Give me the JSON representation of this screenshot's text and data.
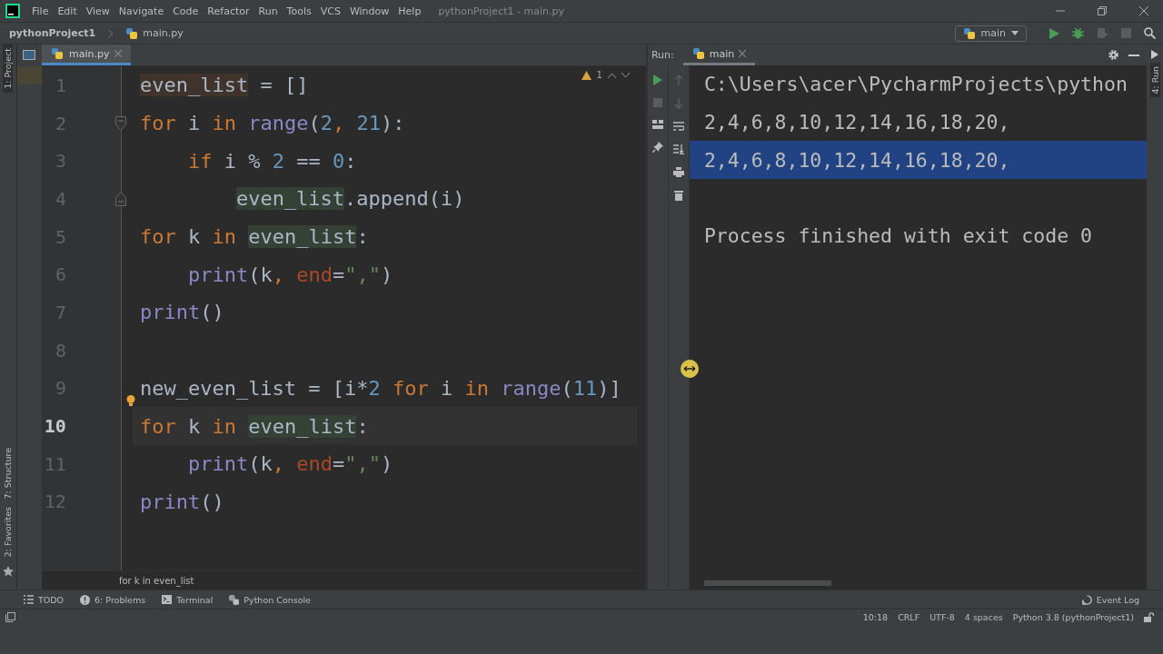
{
  "menu": {
    "items": [
      "File",
      "Edit",
      "View",
      "Navigate",
      "Code",
      "Refactor",
      "Run",
      "Tools",
      "VCS",
      "Window",
      "Help"
    ],
    "title": "pythonProject1 - main.py"
  },
  "navbar": {
    "project": "pythonProject1",
    "file": "main.py",
    "run_config": "main"
  },
  "side_tools": {
    "top": "1: Project",
    "middle": "7: Structure",
    "bottom": "2: Favorites"
  },
  "editor": {
    "tab": {
      "label": "main.py",
      "selected": true
    },
    "inspection": "1",
    "lines": [
      {
        "number": "1",
        "current": false,
        "tokens": [
          {
            "t": "even_list",
            "kind": "write"
          },
          {
            "t": " = []",
            "kind": "plain"
          }
        ]
      },
      {
        "number": "2",
        "current": false,
        "kind": "fold-start",
        "tokens": [
          {
            "t": "for",
            "kind": "keyword"
          },
          {
            "t": " i ",
            "kind": "plain"
          },
          {
            "t": "in",
            "kind": "keyword"
          },
          {
            "t": " range",
            "kind": "builtin"
          },
          {
            "t": "(",
            "kind": "plain"
          },
          {
            "t": "2",
            "kind": "number"
          },
          {
            "t": ", ",
            "kind": "keyword"
          },
          {
            "t": "21",
            "kind": "number"
          },
          {
            "t": "):",
            "kind": "plain"
          }
        ]
      },
      {
        "number": "3",
        "current": false,
        "tokens": [
          {
            "t": "    if",
            "kind": "keyword"
          },
          {
            "t": " i % ",
            "kind": "plain"
          },
          {
            "t": "2",
            "kind": "number"
          },
          {
            "t": " == ",
            "kind": "plain"
          },
          {
            "t": "0",
            "kind": "number"
          },
          {
            "t": ":",
            "kind": "plain"
          }
        ]
      },
      {
        "number": "4",
        "current": false,
        "kind": "fold-end",
        "tokens": [
          {
            "t": "        even_list",
            "kind": "usage"
          },
          {
            "t": ".append(i)",
            "kind": "plain"
          }
        ]
      },
      {
        "number": "5",
        "current": false,
        "tokens": [
          {
            "t": "for",
            "kind": "keyword"
          },
          {
            "t": " k ",
            "kind": "plain"
          },
          {
            "t": "in",
            "kind": "keyword"
          },
          {
            "t": " even_list",
            "kind": "usage"
          },
          {
            "t": ":",
            "kind": "plain"
          }
        ]
      },
      {
        "number": "6",
        "current": false,
        "tokens": [
          {
            "t": "    print",
            "kind": "builtin"
          },
          {
            "t": "(k",
            "kind": "plain"
          },
          {
            "t": ", ",
            "kind": "keyword"
          },
          {
            "t": "end",
            "kind": "param"
          },
          {
            "t": "=",
            "kind": "plain"
          },
          {
            "t": "\",\"",
            "kind": "string"
          },
          {
            "t": ")",
            "kind": "plain"
          }
        ]
      },
      {
        "number": "7",
        "current": false,
        "tokens": [
          {
            "t": "print",
            "kind": "builtin"
          },
          {
            "t": "()",
            "kind": "plain"
          }
        ]
      },
      {
        "number": "8",
        "current": false
      },
      {
        "number": "9",
        "current": false,
        "kind": "bulb",
        "tokens": [
          {
            "t": "new_even_list = [i*",
            "kind": "plain"
          },
          {
            "t": "2",
            "kind": "number"
          },
          {
            "t": " for",
            "kind": "keyword"
          },
          {
            "t": " i ",
            "kind": "plain"
          },
          {
            "t": "in",
            "kind": "keyword"
          },
          {
            "t": " range",
            "kind": "builtin"
          },
          {
            "t": "(",
            "kind": "plain"
          },
          {
            "t": "11",
            "kind": "number"
          },
          {
            "t": ")]",
            "kind": "plain"
          }
        ]
      },
      {
        "number": "10",
        "current": true,
        "tokens": [
          {
            "t": "for",
            "kind": "keyword"
          },
          {
            "t": " k ",
            "kind": "plain"
          },
          {
            "t": "in",
            "kind": "keyword"
          },
          {
            "t": " even_list",
            "kind": "usage"
          },
          {
            "t": ":",
            "kind": "plain"
          }
        ]
      },
      {
        "number": "11",
        "current": false,
        "tokens": [
          {
            "t": "    print",
            "kind": "builtin"
          },
          {
            "t": "(k",
            "kind": "plain"
          },
          {
            "t": ", ",
            "kind": "keyword"
          },
          {
            "t": "end",
            "kind": "param"
          },
          {
            "t": "=",
            "kind": "plain"
          },
          {
            "t": "\",\"",
            "kind": "string"
          },
          {
            "t": ")",
            "kind": "plain"
          }
        ]
      },
      {
        "number": "12",
        "current": false,
        "tokens": [
          {
            "t": "print",
            "kind": "builtin"
          },
          {
            "t": "()",
            "kind": "plain"
          }
        ]
      }
    ],
    "breadcrumb": "for k in even_list"
  },
  "run": {
    "label": "Run:",
    "tab": {
      "label": "main",
      "selected": true
    },
    "side_label": "4: Run",
    "console": [
      {
        "text": "C:\\Users\\acer\\PycharmProjects\\python",
        "selected": false
      },
      {
        "text": "2,4,6,8,10,12,14,16,18,20,",
        "selected": false
      },
      {
        "text": "2,4,6,8,10,12,14,16,18,20,",
        "selected": true
      },
      {
        "selected": false
      },
      {
        "text": "Process finished with exit code 0",
        "selected": false
      }
    ]
  },
  "tool_windows": [
    "TODO",
    "6: Problems",
    "Terminal",
    "Python Console"
  ],
  "event_log": "Event Log",
  "status_bar": [
    "10:18",
    "CRLF",
    "UTF-8",
    "4 spaces",
    "Python 3.8 (pythonProject1)"
  ]
}
